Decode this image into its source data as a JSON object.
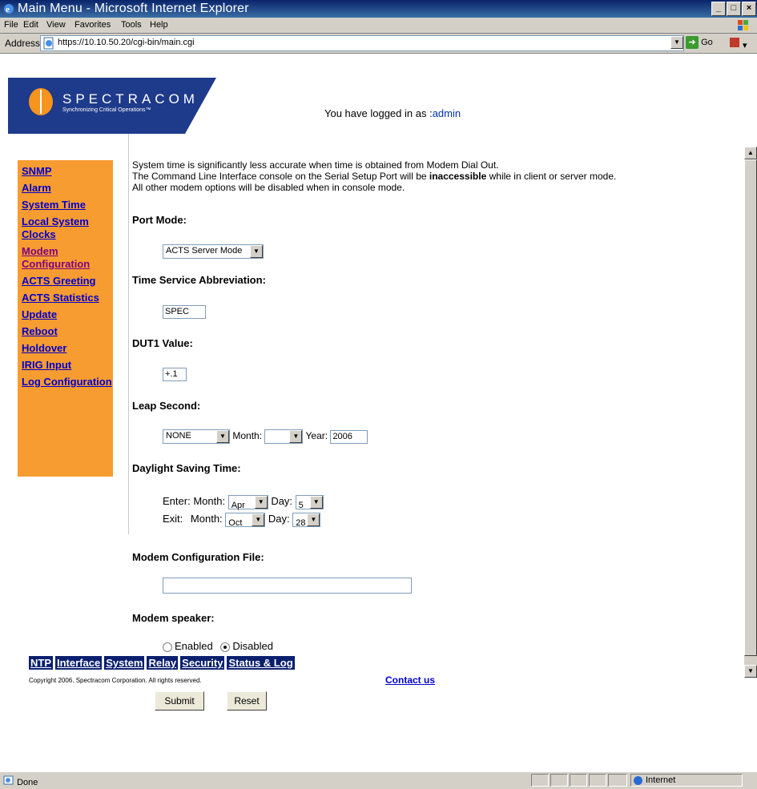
{
  "window": {
    "title": "Main Menu - Microsoft Internet Explorer",
    "controls": [
      "_",
      "□",
      "×"
    ]
  },
  "menubar": {
    "items": [
      "File",
      "Edit",
      "View",
      "Favorites",
      "Tools",
      "Help"
    ]
  },
  "addressbar": {
    "label": "Address",
    "url": "https://10.10.50.20/cgi-bin/main.cgi",
    "go_label": "Go"
  },
  "header": {
    "brand": "SPECTRACOM",
    "tagline": "Synchronizing Critical Operations™",
    "login_prefix": "You have logged in as :",
    "login_user": "admin"
  },
  "sidebar": {
    "items": [
      {
        "label": "SNMP"
      },
      {
        "label": "Alarm"
      },
      {
        "label": "System Time"
      },
      {
        "label": "Local System Clocks"
      },
      {
        "label": "Modem Configuration"
      },
      {
        "label": "ACTS Greeting"
      },
      {
        "label": "ACTS Statistics"
      },
      {
        "label": "Update"
      },
      {
        "label": "Reboot"
      },
      {
        "label": "Holdover"
      },
      {
        "label": "IRIG Input"
      },
      {
        "label": "Log Configuration"
      }
    ]
  },
  "main": {
    "note1": "System time is significantly less accurate when time is obtained from Modem Dial Out.",
    "note2_pre": "The Command Line Interface console on the Serial Setup Port will be ",
    "note2_bold": "inaccessible",
    "note2_post": " while in client or server mode.",
    "note3": "All other modem options will be disabled when in console mode.",
    "port_mode": {
      "label": "Port Mode:",
      "value": "ACTS Server Mode"
    },
    "time_service": {
      "label": "Time Service Abbreviation:",
      "value": "SPEC"
    },
    "dut1": {
      "label": "DUT1 Value:",
      "value": "+.1"
    },
    "leap": {
      "label": "Leap Second:",
      "value": "NONE",
      "month_label": "Month:",
      "month_value": "",
      "year_label": "Year:",
      "year_value": "2006"
    },
    "dst": {
      "label": "Daylight Saving Time:",
      "enter_label": "Enter:",
      "exit_label": "Exit:",
      "month_label": "Month:",
      "day_label": "Day:",
      "enter_month": "Apr",
      "enter_day": "5",
      "exit_month": "Oct",
      "exit_day": "28"
    },
    "config_file": {
      "label": "Modem Configuration File:",
      "value": ""
    },
    "speaker": {
      "label": "Modem speaker:",
      "enabled_label": "Enabled",
      "disabled_label": "Disabled",
      "selected": "Disabled"
    },
    "submit_label": "Submit",
    "reset_label": "Reset"
  },
  "footer": {
    "nav": [
      "NTP",
      "Interface",
      "System",
      "Relay",
      "Security",
      "Status & Log"
    ],
    "copyright": "Copyright 2006. Spectracom Corporation. All rights reserved.",
    "contact": "Contact us"
  },
  "statusbar": {
    "status": "Done",
    "zone": "Internet"
  },
  "colors": {
    "sidebar_bg": "#f79c30",
    "brand_blue": "#1e3a8a",
    "link": "#0000cc",
    "footer_nav_bg": "#0a1f6e"
  }
}
